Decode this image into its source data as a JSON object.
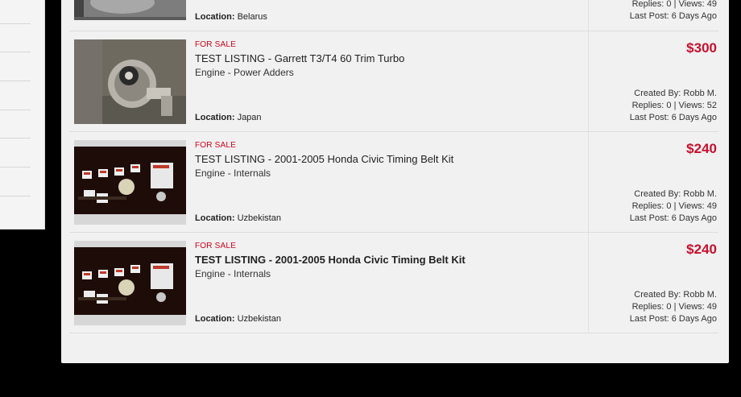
{
  "top_partial": {
    "location_label": "Location:",
    "location": "Belarus",
    "replies_views": "Replies: 0 | Views: 49",
    "last_post": "Last Post: 6 Days Ago"
  },
  "listings": [
    {
      "status": "FOR SALE",
      "title": "TEST LISTING - Garrett T3/T4 60 Trim Turbo",
      "category": "Engine - Power Adders",
      "location_label": "Location:",
      "location": "Japan",
      "price": "$300",
      "created_by": "Created By: Robb M.",
      "replies_views": "Replies: 0 | Views: 52",
      "last_post": "Last Post: 6 Days Ago"
    },
    {
      "status": "FOR SALE",
      "title": "TEST LISTING - 2001-2005 Honda Civic Timing Belt Kit",
      "category": "Engine - Internals",
      "location_label": "Location:",
      "location": "Uzbekistan",
      "price": "$240",
      "created_by": "Created By: Robb M.",
      "replies_views": "Replies: 0 | Views: 49",
      "last_post": "Last Post: 6 Days Ago"
    },
    {
      "status": "FOR SALE",
      "title": "TEST LISTING - 2001-2005 Honda Civic Timing Belt Kit",
      "category": "Engine - Internals",
      "location_label": "Location:",
      "location": "Uzbekistan",
      "price": "$240",
      "created_by": "Created By: Robb M.",
      "replies_views": "Replies: 0 | Views: 49",
      "last_post": "Last Post: 6 Days Ago"
    }
  ],
  "colors": {
    "accent_red": "#c8102e",
    "status_red": "#d0021b",
    "panel_bg": "#f1f1f1"
  }
}
